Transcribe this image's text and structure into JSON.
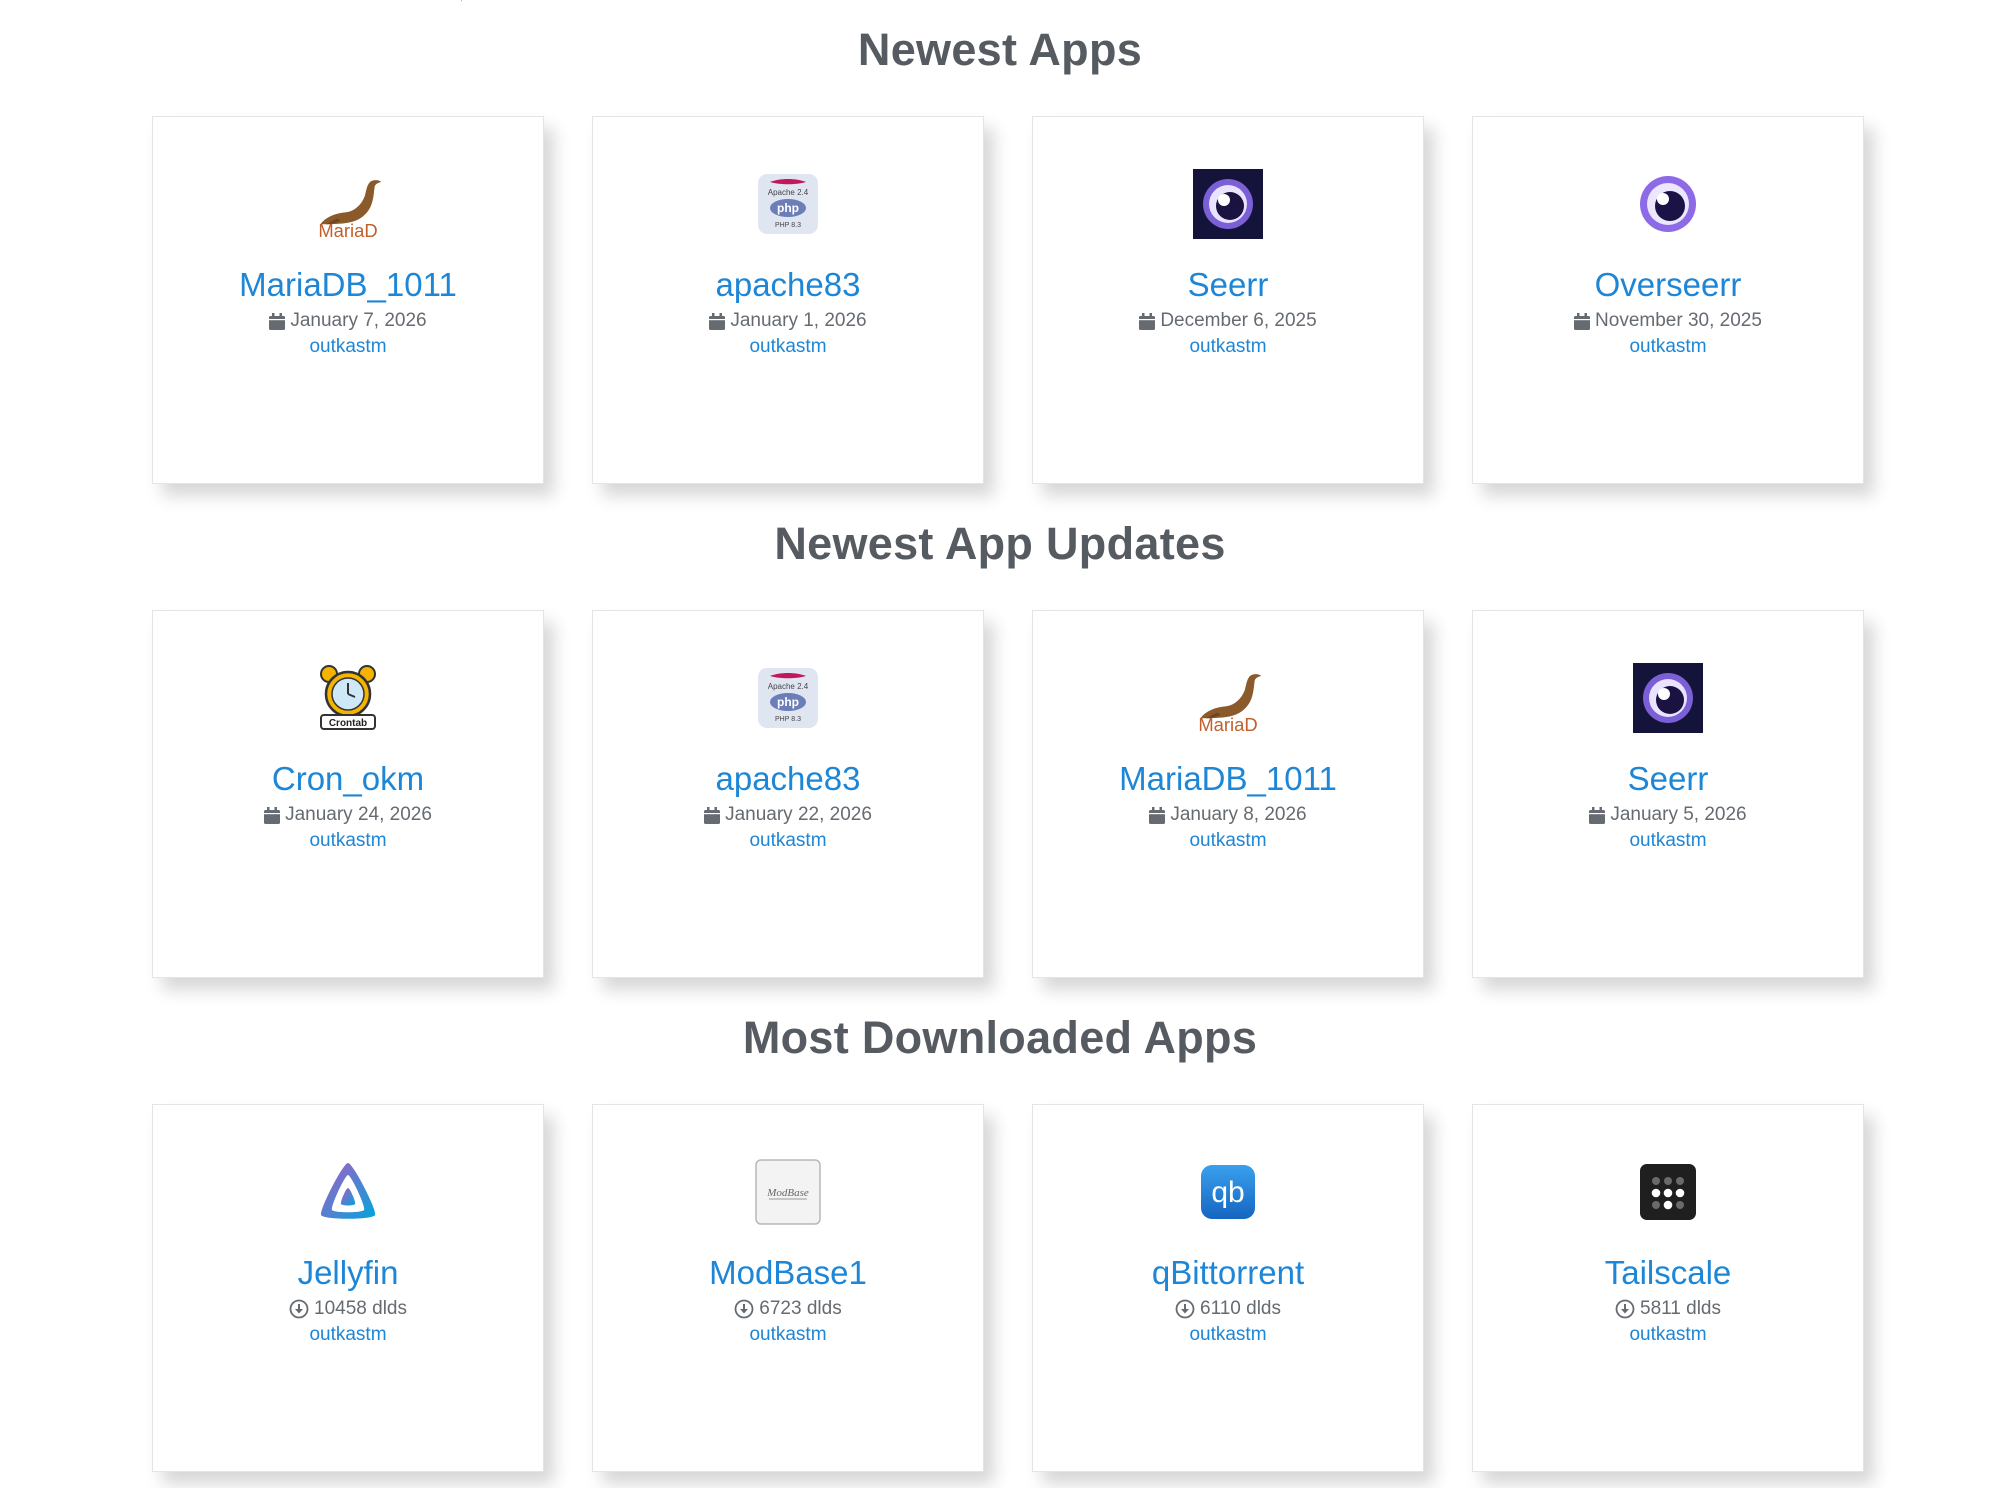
{
  "sections": [
    {
      "title": "Newest Apps",
      "cards": [
        {
          "icon": "mariadb-seal-icon",
          "name": "MariaDB_1011",
          "meta_icon": "calendar-icon",
          "meta": "January 7, 2026",
          "author": "outkastm"
        },
        {
          "icon": "apache-php-icon",
          "name": "apache83",
          "meta_icon": "calendar-icon",
          "meta": "January 1, 2026",
          "author": "outkastm"
        },
        {
          "icon": "seerr-dark-icon",
          "name": "Seerr",
          "meta_icon": "calendar-icon",
          "meta": "December 6, 2025",
          "author": "outkastm"
        },
        {
          "icon": "overseerr-icon",
          "name": "Overseerr",
          "meta_icon": "calendar-icon",
          "meta": "November 30, 2025",
          "author": "outkastm"
        }
      ]
    },
    {
      "title": "Newest App Updates",
      "cards": [
        {
          "icon": "crontab-alarm-clock-icon",
          "name": "Cron_okm",
          "meta_icon": "calendar-icon",
          "meta": "January 24, 2026",
          "author": "outkastm"
        },
        {
          "icon": "apache-php-icon",
          "name": "apache83",
          "meta_icon": "calendar-icon",
          "meta": "January 22, 2026",
          "author": "outkastm"
        },
        {
          "icon": "mariadb-seal-icon",
          "name": "MariaDB_1011",
          "meta_icon": "calendar-icon",
          "meta": "January 8, 2026",
          "author": "outkastm"
        },
        {
          "icon": "seerr-dark-icon",
          "name": "Seerr",
          "meta_icon": "calendar-icon",
          "meta": "January 5, 2026",
          "author": "outkastm"
        }
      ]
    },
    {
      "title": "Most Downloaded Apps",
      "cards": [
        {
          "icon": "jellyfin-icon",
          "name": "Jellyfin",
          "meta_icon": "download-icon",
          "meta": "10458 dlds",
          "author": "outkastm"
        },
        {
          "icon": "modbase-icon",
          "name": "ModBase1",
          "meta_icon": "download-icon",
          "meta": "6723 dlds",
          "author": "outkastm"
        },
        {
          "icon": "qbittorrent-icon",
          "name": "qBittorrent",
          "meta_icon": "download-icon",
          "meta": "6110 dlds",
          "author": "outkastm"
        },
        {
          "icon": "tailscale-icon",
          "name": "Tailscale",
          "meta_icon": "download-icon",
          "meta": "5811 dlds",
          "author": "outkastm"
        }
      ]
    }
  ],
  "icon_text": {
    "mariadb": "MariaD",
    "apache_top": "Apache 2.4",
    "apache_php": "php",
    "apache_ver": "PHP 8.3",
    "crontab": "Crontab",
    "qbittorrent": "qb",
    "modbase": "ModBase"
  },
  "colors": {
    "link": "#1d86d6",
    "heading": "#555b61",
    "meta_text": "#656b71",
    "card_border": "#e2e4e7"
  }
}
